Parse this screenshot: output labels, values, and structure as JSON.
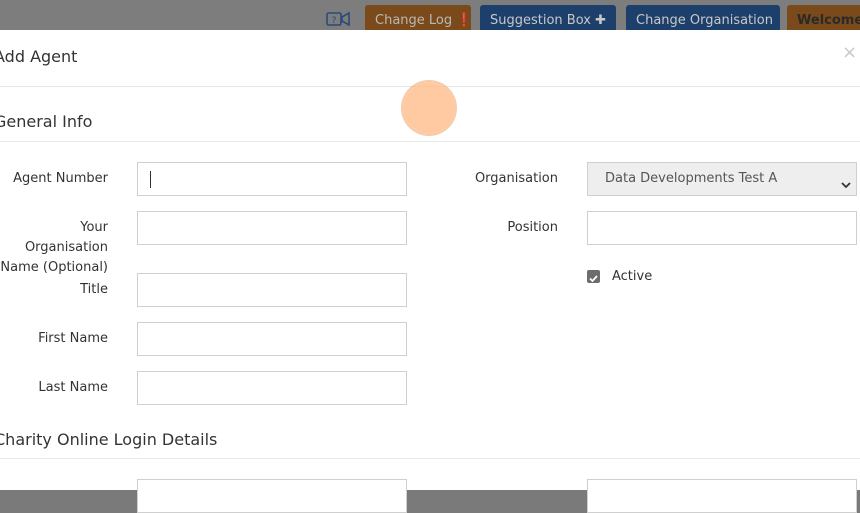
{
  "topbar": {
    "change_log": "Change Log ❗",
    "suggestion_box": "Suggestion Box ✚",
    "change_organisation": "Change Organisation",
    "welcome": "Welcome"
  },
  "modal": {
    "title": "Add Agent",
    "close": "×"
  },
  "sections": {
    "general_info": "General Info",
    "login_details": "Charity Online Login Details"
  },
  "fields": {
    "agent_number": {
      "label": "Agent Number",
      "value": ""
    },
    "your_org_name": {
      "label_line1": "Your Organisation",
      "label_line2": "Name (Optional)",
      "value": ""
    },
    "title": {
      "label": "Title",
      "value": ""
    },
    "first_name": {
      "label": "First Name",
      "value": ""
    },
    "last_name": {
      "label": "Last Name",
      "value": ""
    },
    "organisation": {
      "label": "Organisation",
      "selected": "Data Developments Test A"
    },
    "position": {
      "label": "Position",
      "value": ""
    },
    "active": {
      "label": "Active",
      "checked": true
    }
  },
  "colors": {
    "change_log_bg": "#7a4a1a",
    "primary_bg": "#1d3f6b",
    "cursor_highlight": "#ffc192"
  },
  "icons": {
    "video": "video-camera-icon",
    "close": "close-icon",
    "chevron": "chevron-down-icon",
    "check": "checkmark-icon"
  }
}
